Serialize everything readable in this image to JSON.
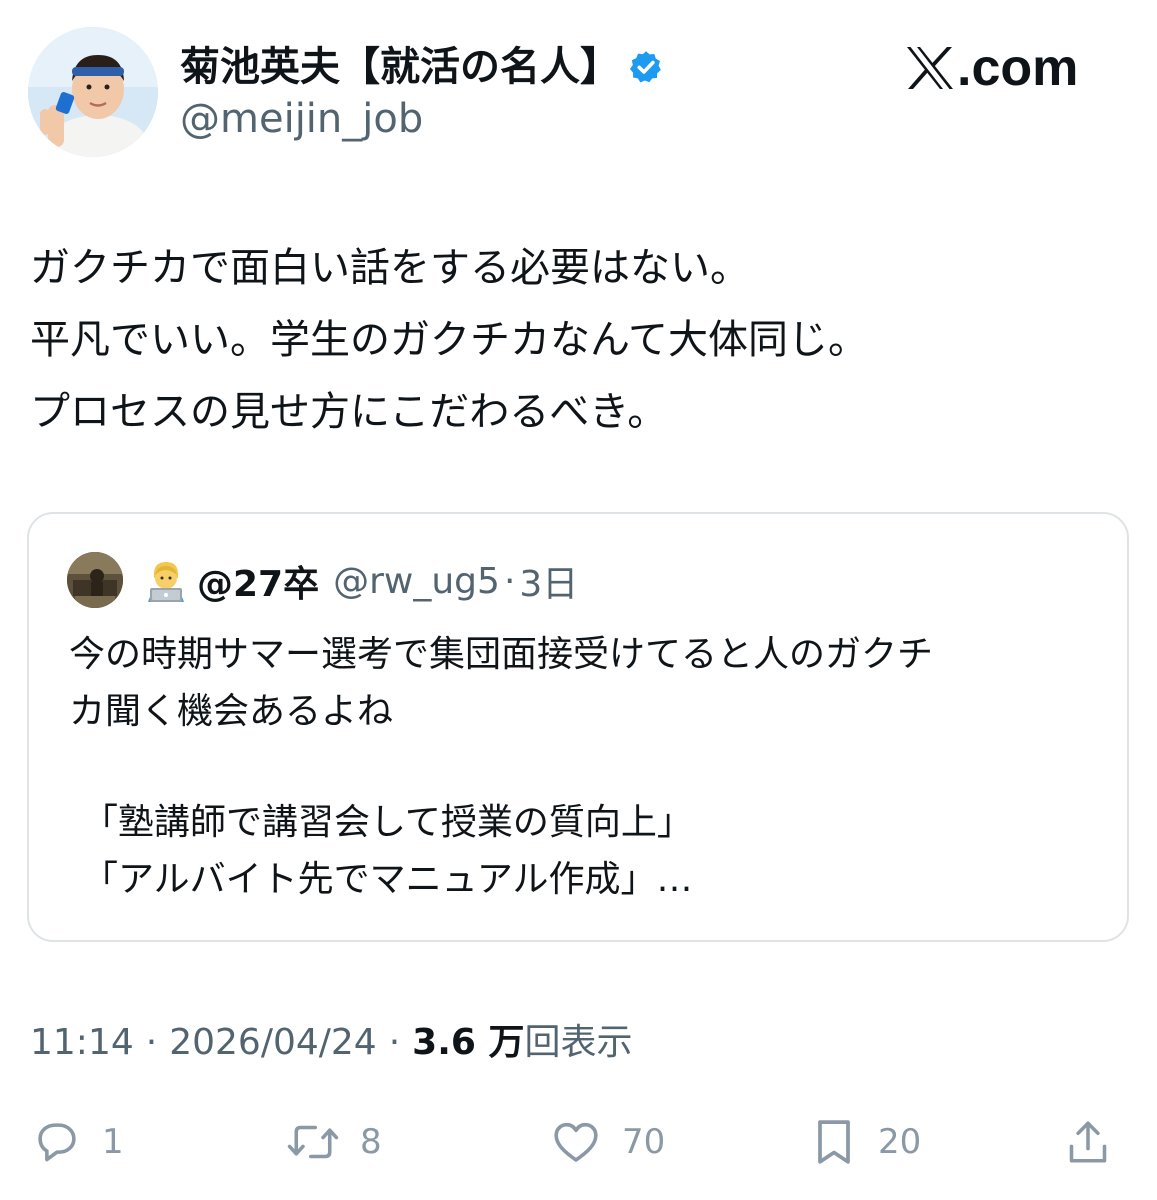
{
  "author": {
    "display_name": "菊池英夫【就活の名人】",
    "handle": "@meijin_job",
    "verified": true,
    "avatar_icon": "profile-photo"
  },
  "site": {
    "logo_text": ".com",
    "logo_icon": "x-logo-icon"
  },
  "tweet": {
    "lines": [
      "ガクチカで面白い話をする必要はない。",
      "平凡でいい。学生のガクチカなんて大体同じ。",
      "プロセスの見せ方にこだわるべき。"
    ]
  },
  "quote": {
    "avatar_icon": "profile-photo",
    "emoji_icon": "technologist-emoji-icon",
    "name": "@27卒",
    "handle": "@rw_ug5",
    "dot": "·",
    "time": "3日",
    "lines": [
      "今の時期サマー選考で集団面接受けてると人のガクチ",
      "カ聞く機会あるよね"
    ],
    "examples": [
      "「塾講師で講習会して授業の質向上」",
      "「アルバイト先でマニュアル作成」…"
    ]
  },
  "meta": {
    "time": "11:14",
    "sep": "·",
    "date": "2026/04/24",
    "views_count": "3.6 万",
    "views_label": "回表示"
  },
  "actions": {
    "reply_count": "1",
    "retweet_count": "8",
    "like_count": "70",
    "bookmark_count": "20",
    "colors": {
      "icon": "#8b98a5",
      "verified": "#1d9bf0"
    }
  }
}
